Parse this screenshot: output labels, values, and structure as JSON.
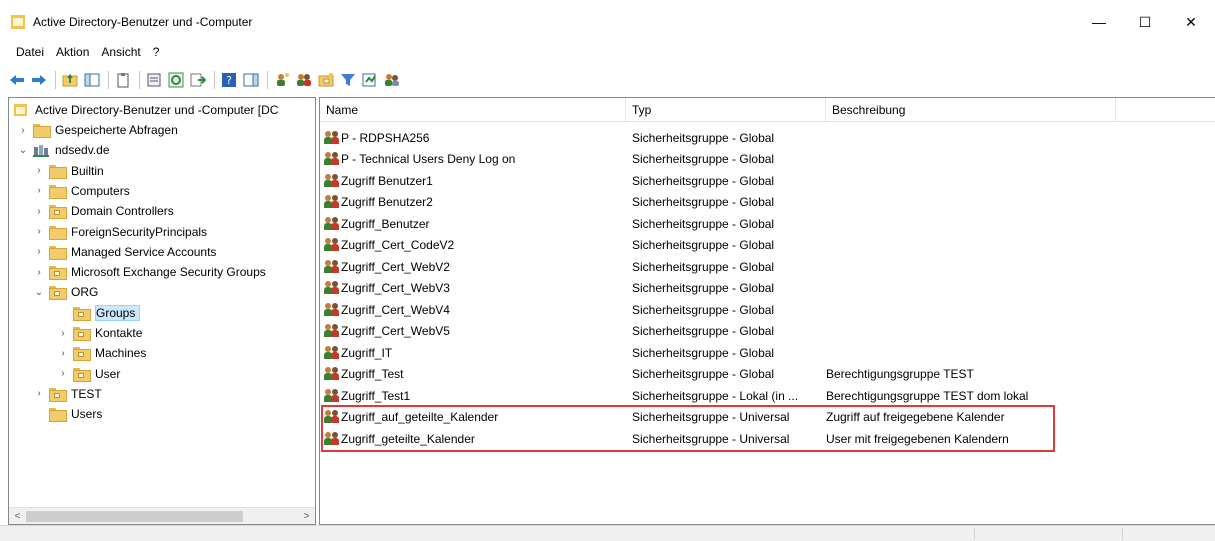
{
  "window": {
    "title": "Active Directory-Benutzer und -Computer",
    "minimize_glyph": "—",
    "maximize_glyph": "☐",
    "close_glyph": "✕"
  },
  "menu": [
    "Datei",
    "Aktion",
    "Ansicht",
    "?"
  ],
  "tree": {
    "root_label": "Active Directory-Benutzer und -Computer [DC",
    "items": [
      {
        "label": "Gespeicherte Abfragen",
        "level": 1,
        "twisty": "›",
        "kind": "folder"
      },
      {
        "label": "ndsedv.de",
        "level": 1,
        "twisty": "⌄",
        "kind": "domain"
      },
      {
        "label": "Builtin",
        "level": 2,
        "twisty": "›",
        "kind": "folder"
      },
      {
        "label": "Computers",
        "level": 2,
        "twisty": "›",
        "kind": "folder"
      },
      {
        "label": "Domain Controllers",
        "level": 2,
        "twisty": "›",
        "kind": "ou"
      },
      {
        "label": "ForeignSecurityPrincipals",
        "level": 2,
        "twisty": "›",
        "kind": "folder"
      },
      {
        "label": "Managed Service Accounts",
        "level": 2,
        "twisty": "›",
        "kind": "folder"
      },
      {
        "label": "Microsoft Exchange Security Groups",
        "level": 2,
        "twisty": "›",
        "kind": "ou"
      },
      {
        "label": "ORG",
        "level": 2,
        "twisty": "⌄",
        "kind": "ou"
      },
      {
        "label": "Groups",
        "level": 3,
        "twisty": "",
        "kind": "ou",
        "selected": true
      },
      {
        "label": "Kontakte",
        "level": 3,
        "twisty": "›",
        "kind": "ou"
      },
      {
        "label": "Machines",
        "level": 3,
        "twisty": "›",
        "kind": "ou"
      },
      {
        "label": "User",
        "level": 3,
        "twisty": "›",
        "kind": "ou"
      },
      {
        "label": "TEST",
        "level": 2,
        "twisty": "›",
        "kind": "ou"
      },
      {
        "label": "Users",
        "level": 2,
        "twisty": "",
        "kind": "folder"
      }
    ]
  },
  "list": {
    "columns": [
      "Name",
      "Typ",
      "Beschreibung"
    ],
    "rows": [
      {
        "name": "P - RDPSHA256",
        "type": "Sicherheitsgruppe - Global",
        "desc": ""
      },
      {
        "name": "P - Technical Users Deny Log on",
        "type": "Sicherheitsgruppe - Global",
        "desc": ""
      },
      {
        "name": "Zugriff Benutzer1",
        "type": "Sicherheitsgruppe - Global",
        "desc": ""
      },
      {
        "name": "Zugriff Benutzer2",
        "type": "Sicherheitsgruppe - Global",
        "desc": ""
      },
      {
        "name": "Zugriff_Benutzer",
        "type": "Sicherheitsgruppe - Global",
        "desc": ""
      },
      {
        "name": "Zugriff_Cert_CodeV2",
        "type": "Sicherheitsgruppe - Global",
        "desc": ""
      },
      {
        "name": "Zugriff_Cert_WebV2",
        "type": "Sicherheitsgruppe - Global",
        "desc": ""
      },
      {
        "name": "Zugriff_Cert_WebV3",
        "type": "Sicherheitsgruppe - Global",
        "desc": ""
      },
      {
        "name": "Zugriff_Cert_WebV4",
        "type": "Sicherheitsgruppe - Global",
        "desc": ""
      },
      {
        "name": "Zugriff_Cert_WebV5",
        "type": "Sicherheitsgruppe - Global",
        "desc": ""
      },
      {
        "name": "Zugriff_IT",
        "type": "Sicherheitsgruppe - Global",
        "desc": ""
      },
      {
        "name": "Zugriff_Test",
        "type": "Sicherheitsgruppe - Global",
        "desc": "Berechtigungsgruppe TEST"
      },
      {
        "name": "Zugriff_Test1",
        "type": "Sicherheitsgruppe - Lokal (in ...",
        "desc": "Berechtigungsgruppe TEST dom lokal"
      },
      {
        "name": "Zugriff_auf_geteilte_Kalender",
        "type": "Sicherheitsgruppe - Universal",
        "desc": "Zugriff auf freigegebene Kalender"
      },
      {
        "name": "Zugriff_geteilte_Kalender",
        "type": "Sicherheitsgruppe - Universal",
        "desc": "User mit freigegebenen Kalendern"
      }
    ]
  },
  "colors": {
    "highlight_border": "#e0393a",
    "selection": "#cce8ff"
  }
}
